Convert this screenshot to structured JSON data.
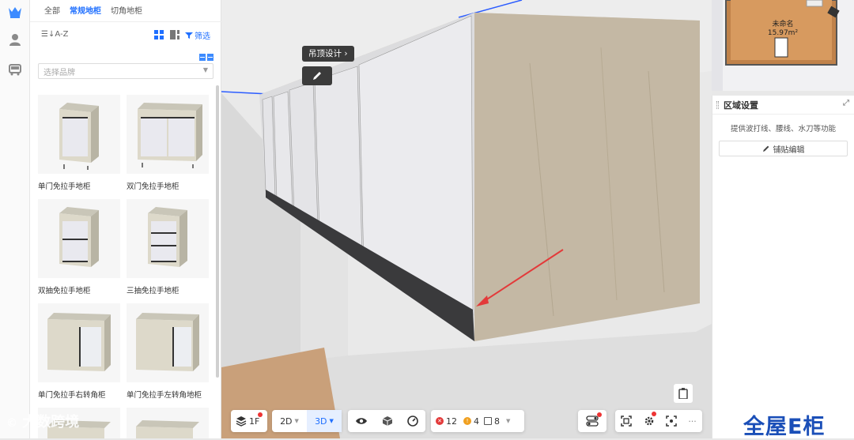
{
  "library": {
    "tabs": [
      "全部",
      "常规地柜",
      "切角地柜"
    ],
    "sort_label": "A-Z",
    "filter_label": "筛选",
    "brand_placeholder": "选择品牌",
    "items": [
      {
        "label": "单门免拉手地柜"
      },
      {
        "label": "双门免拉手地柜"
      },
      {
        "label": "双抽免拉手地柜"
      },
      {
        "label": "三抽免拉手地柜"
      },
      {
        "label": "单门免拉手右转角柜"
      },
      {
        "label": "单门免拉手左转角地柜"
      }
    ]
  },
  "viewport": {
    "tooltip": "吊顶设计",
    "toolbar": {
      "floor": "1F",
      "mode_2d": "2D",
      "mode_3d": "3D",
      "error_count": "12",
      "warning_count": "4",
      "item_count": "8"
    }
  },
  "minimap": {
    "room_name": "未命名",
    "room_area": "15.97m²"
  },
  "region_panel": {
    "title": "区域设置",
    "description": "提供波打线、腰线、水刀等功能",
    "tile_edit_label": "铺贴编辑"
  },
  "watermark": "大数跨境",
  "brand_logo": "全屋E柜",
  "colors": {
    "accent": "#1f6fff",
    "error": "#e33a3a",
    "warning": "#f0a020"
  }
}
